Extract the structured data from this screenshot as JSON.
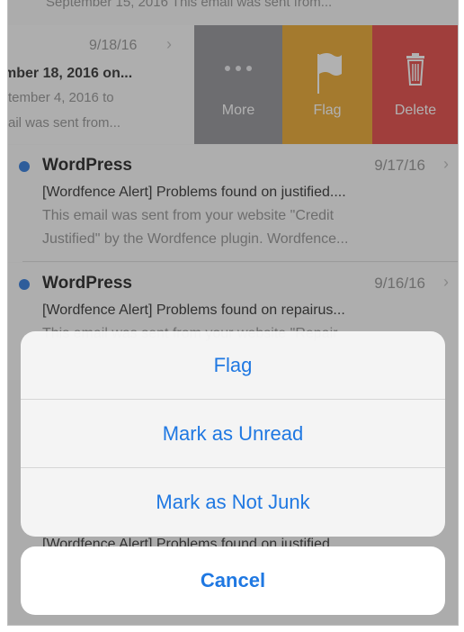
{
  "list": {
    "top_snippet": "September 15, 2016 This email was sent from...",
    "swiped_email": {
      "date": "9/18/16",
      "subject": "mber 18, 2016 on...",
      "preview_line1": "tember 4, 2016 to",
      "preview_line2": "ail was sent from..."
    },
    "emails": [
      {
        "sender": "WordPress",
        "date": "9/17/16",
        "subject": "[Wordfence Alert] Problems found on justified....",
        "preview_line1": "This email was sent from your website \"Credit",
        "preview_line2": "Justified\" by the Wordfence plugin. Wordfence..."
      },
      {
        "sender": "WordPress",
        "date": "9/16/16",
        "subject": "[Wordfence Alert] Problems found on repairus...",
        "preview_line1": "This email was sent from your website \"Repair",
        "preview_line2": ""
      }
    ],
    "bottom_peek_subject": "[Wordfence Alert] Problems found on justified"
  },
  "swipe_actions": {
    "more_label": "More",
    "flag_label": "Flag",
    "delete_label": "Delete",
    "colors": {
      "more": "#8b8b90",
      "flag": "#e8a01e",
      "delete": "#e23a36"
    }
  },
  "action_sheet": {
    "options": [
      "Flag",
      "Mark as Unread",
      "Mark as Not Junk"
    ],
    "cancel_label": "Cancel",
    "accent_color": "#1f78e2"
  },
  "icons": {
    "chevron": "chevron-right-icon",
    "more": "ellipsis-icon",
    "flag": "flag-icon",
    "delete": "trash-icon"
  }
}
